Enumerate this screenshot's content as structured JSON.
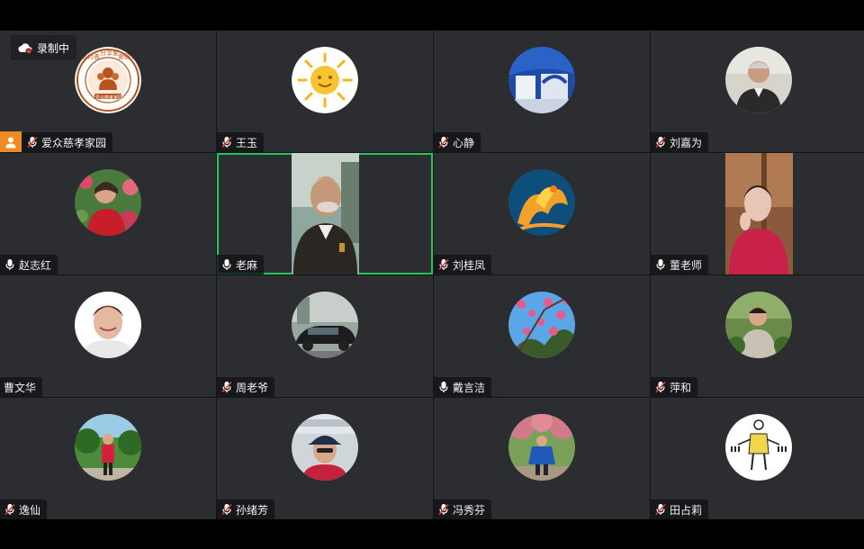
{
  "recording": {
    "label": "录制中",
    "icon": "cloud-record-icon",
    "dot_color": "#e53935"
  },
  "participants": [
    {
      "name": "爱众慈孝家园",
      "muted": true,
      "host": true,
      "avatar": "logo-seal",
      "logo_text": [
        "感为善",
        "分享爱",
        "谢德智",
        "爱众慈孝家园"
      ]
    },
    {
      "name": "王玉",
      "muted": true,
      "avatar": "sun-cartoon"
    },
    {
      "name": "心静",
      "muted": true,
      "avatar": "room-photo"
    },
    {
      "name": "刘嘉为",
      "muted": true,
      "avatar": "man-portrait"
    },
    {
      "name": "赵志红",
      "muted": false,
      "avatar": "woman-flowers"
    },
    {
      "name": "老麻",
      "muted": false,
      "avatar": "video-man",
      "active_speaker": true,
      "video": true
    },
    {
      "name": "刘桂凤",
      "muted": true,
      "avatar": "phoenix-art"
    },
    {
      "name": "董老师",
      "muted": false,
      "avatar": "video-woman",
      "video": true
    },
    {
      "name": "曹文华",
      "muted": null,
      "avatar": "woman-white-bg"
    },
    {
      "name": "周老爷",
      "muted": true,
      "avatar": "car-photo"
    },
    {
      "name": "戴言洁",
      "muted": false,
      "avatar": "blossom-sky"
    },
    {
      "name": "萍和",
      "muted": true,
      "avatar": "woman-outdoor"
    },
    {
      "name": "逸仙",
      "muted": true,
      "avatar": "woman-park"
    },
    {
      "name": "孙绪芳",
      "muted": true,
      "avatar": "woman-cap"
    },
    {
      "name": "冯秀芬",
      "muted": true,
      "avatar": "woman-tree"
    },
    {
      "name": "田占莉",
      "muted": true,
      "avatar": "calligraphy-figure"
    }
  ],
  "colors": {
    "tile_bg": "#2b2d30",
    "active_border": "#22c55e",
    "host_badge": "#f08a24",
    "muted_red": "#e53935"
  }
}
